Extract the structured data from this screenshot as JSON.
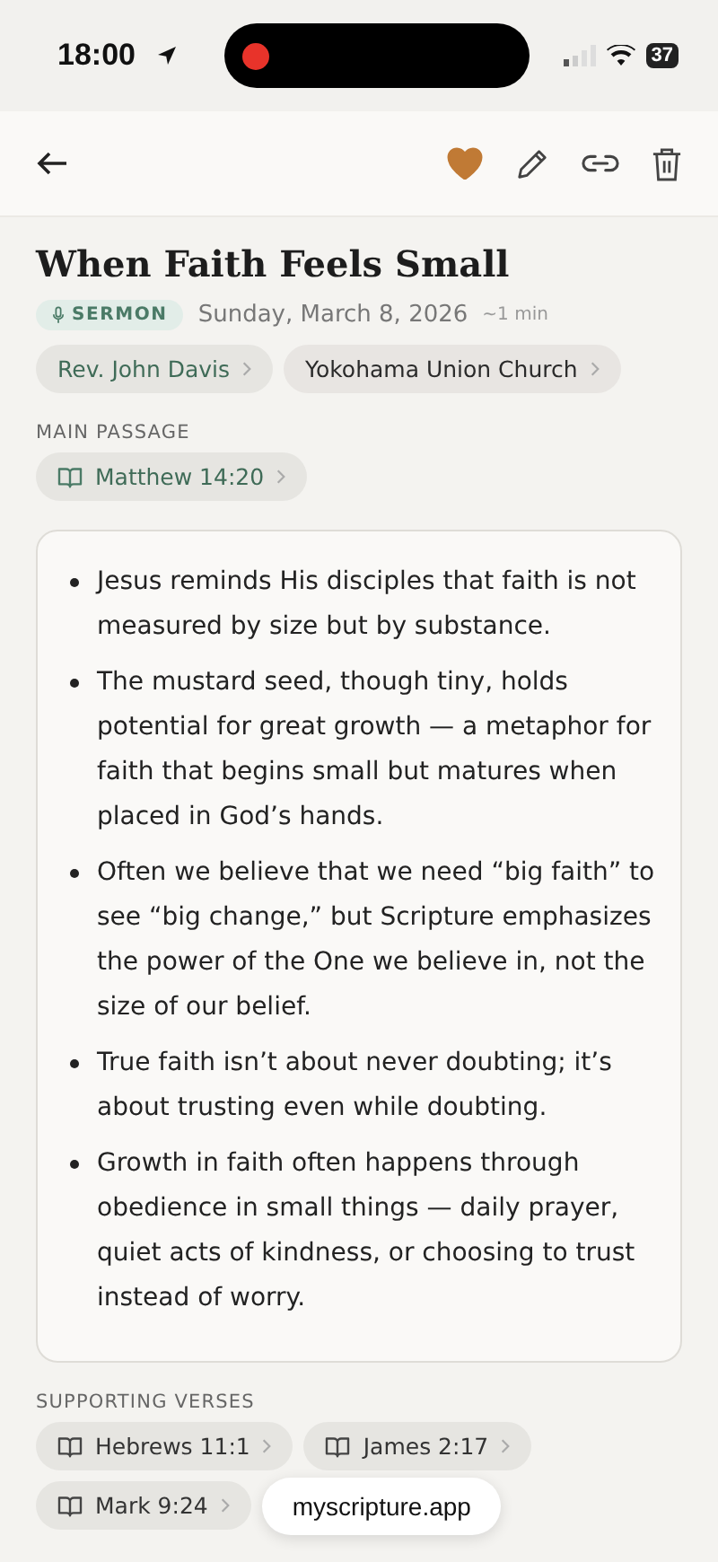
{
  "status_bar": {
    "time": "18:00",
    "battery": "37"
  },
  "toolbar": {
    "favorite": true
  },
  "title": "When Faith Feels Small",
  "type_badge": "SERMON",
  "date": "Sunday, March 8, 2026",
  "duration": "~1 min",
  "chips": [
    {
      "label": "Rev. John Davis",
      "kind": "speaker"
    },
    {
      "label": "Yokohama Union Church",
      "kind": "place"
    }
  ],
  "main_passage": {
    "heading": "MAIN PASSAGE",
    "reference": "Matthew 14:20"
  },
  "notes": [
    "Jesus reminds His disciples that faith is not measured by size but by substance.",
    "The mustard seed, though tiny, holds potential for great growth — a metaphor for faith that begins small but matures when placed in God’s hands.",
    "Often we believe that we need “big faith” to see “big change,” but Scripture emphasizes the power of the One we believe in, not the size of our belief.",
    "True faith isn’t about never doubting; it’s about trusting even while doubting.",
    "Growth in faith often happens through obedience in small things — daily prayer, quiet acts of kindness, or choosing to trust instead of worry."
  ],
  "supporting_verses": {
    "heading": "SUPPORTING VERSES",
    "references": [
      "Hebrews 11:1",
      "James 2:17",
      "Mark 9:24"
    ]
  },
  "url_pill": "myscripture.app"
}
